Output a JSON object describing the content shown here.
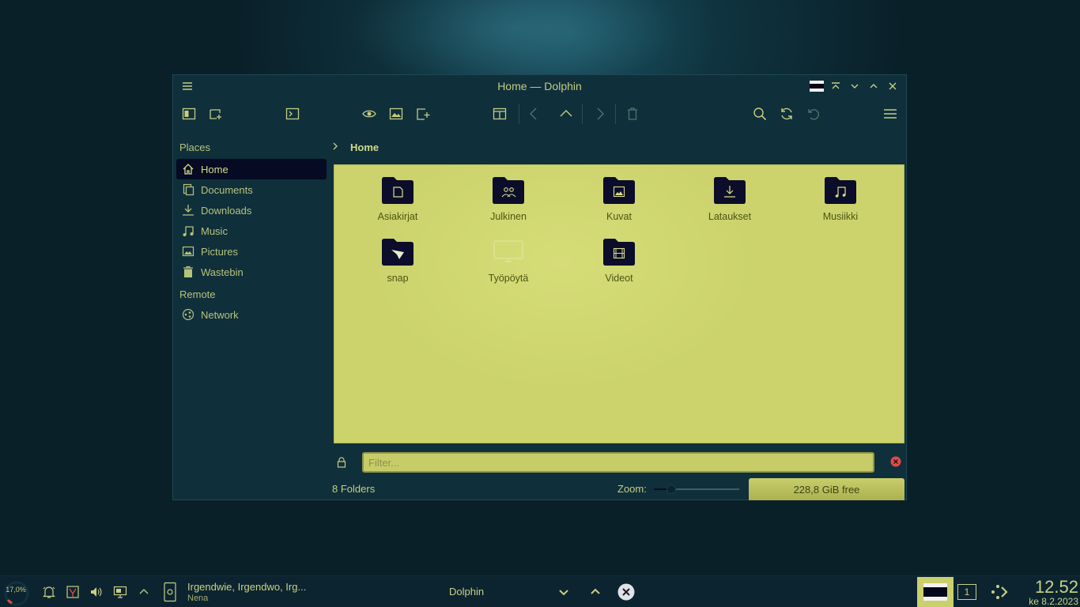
{
  "window": {
    "title": "Home — Dolphin"
  },
  "sidebar": {
    "places_title": "Places",
    "places": [
      {
        "label": "Home",
        "icon": "home-icon",
        "active": true
      },
      {
        "label": "Documents",
        "icon": "documents-icon"
      },
      {
        "label": "Downloads",
        "icon": "downloads-icon"
      },
      {
        "label": "Music",
        "icon": "music-icon"
      },
      {
        "label": "Pictures",
        "icon": "pictures-icon"
      },
      {
        "label": "Wastebin",
        "icon": "wastebin-icon"
      }
    ],
    "remote_title": "Remote",
    "remote": [
      {
        "label": "Network",
        "icon": "network-icon"
      }
    ]
  },
  "breadcrumb": {
    "label": "Home"
  },
  "items": [
    {
      "name": "Asiakirjat",
      "icon": "document-folder-icon"
    },
    {
      "name": "Julkinen",
      "icon": "public-folder-icon"
    },
    {
      "name": "Kuvat",
      "icon": "pictures-folder-icon"
    },
    {
      "name": "Lataukset",
      "icon": "downloads-folder-icon"
    },
    {
      "name": "Musiikki",
      "icon": "music-folder-icon"
    },
    {
      "name": "snap",
      "icon": "snap-folder-icon"
    },
    {
      "name": "Työpöytä",
      "icon": "desktop-folder-icon"
    },
    {
      "name": "Videot",
      "icon": "videos-folder-icon"
    }
  ],
  "filter": {
    "placeholder": "Filter..."
  },
  "status": {
    "summary": "8 Folders",
    "zoom_label": "Zoom:",
    "zoom_level": 0.2,
    "free_space": "228,8 GiB free",
    "used_fraction": 0.0
  },
  "panel": {
    "cpu_load": "17,0%",
    "task_title": "Irgendwie, Irgendwo, Irg...",
    "task_subtitle": "Nena",
    "task_dolphin": "Dolphin",
    "pager_number": "1",
    "clock_time": "12.52",
    "clock_date": "ke 8.2.2023"
  },
  "colors": {
    "accent": "#ccd36d",
    "window_bg": "#0f2f3b",
    "panel_bg": "#0c2430",
    "folder": "#0b0d2a",
    "active_place": "#060a22"
  }
}
